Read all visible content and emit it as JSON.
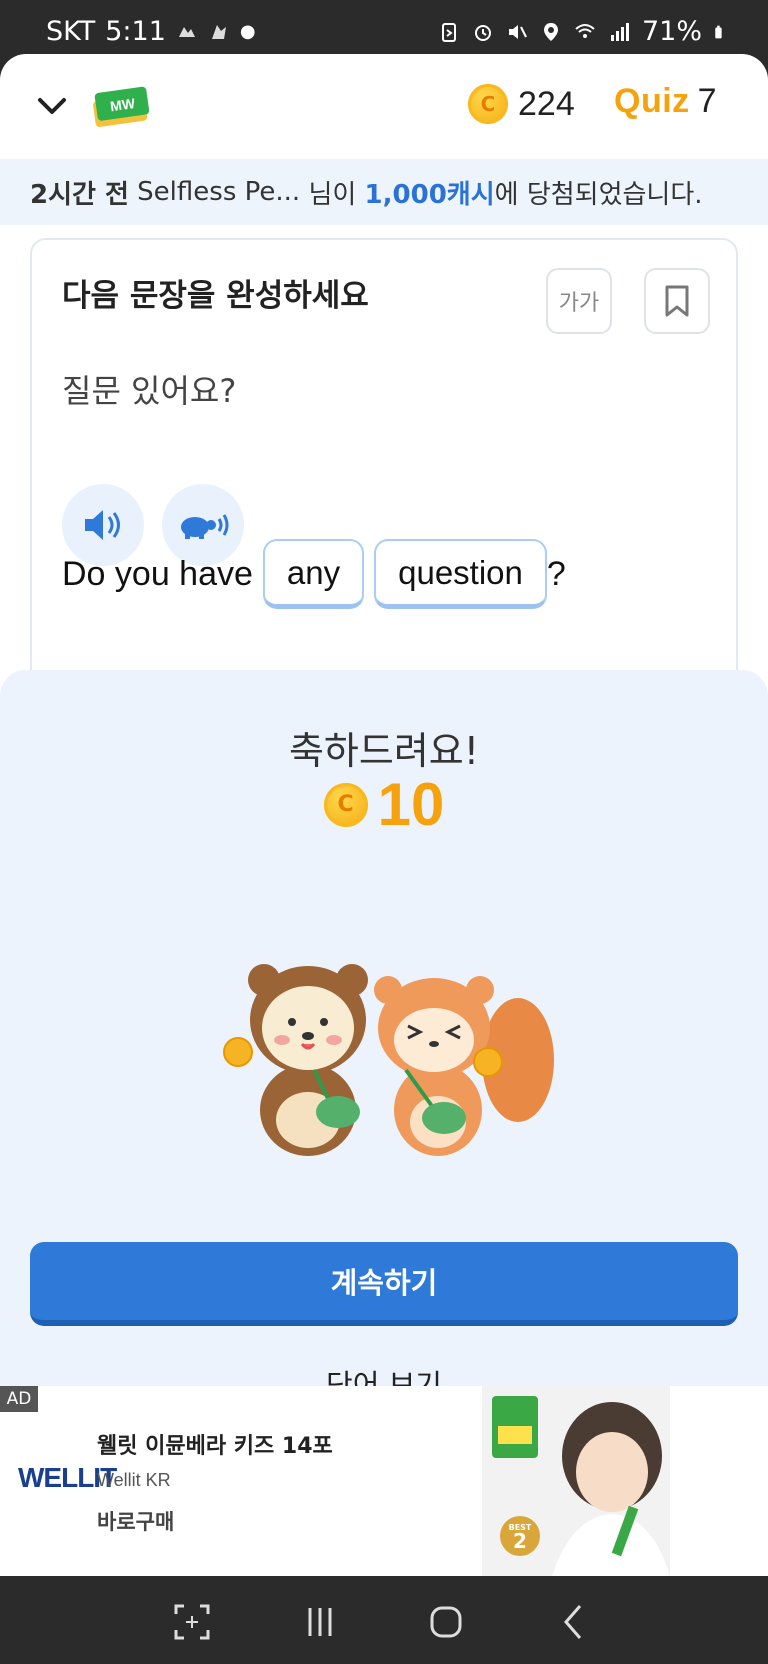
{
  "status_bar": {
    "carrier": "SKT",
    "time": "5:11",
    "battery": "71%"
  },
  "header": {
    "logo_text": "MW",
    "coin_count": "224",
    "quiz_label": "Quiz",
    "quiz_count": "7"
  },
  "banner": {
    "time_ago": "2시간 전",
    "user": "Selfless Pe...",
    "mid": "님이",
    "amount": "1,000캐시",
    "suffix": "에 당첨되었습니다."
  },
  "quiz_card": {
    "title": "다음 문장을 완성하세요",
    "font_size_button": "가가",
    "question": "질문 있어요?",
    "sentence_prefix": "Do you have",
    "answers": [
      "any",
      "question"
    ],
    "sentence_suffix": "?"
  },
  "result": {
    "message": "축하드려요!",
    "reward": "10",
    "continue_label": "계속하기",
    "view_words_label": "단어 보기"
  },
  "ad": {
    "tag": "AD",
    "brand": "WELLIT",
    "title": "웰릿 이뮨베라 키즈 14포",
    "advertiser": "Wellit KR",
    "cta": "바로구매",
    "badge_label": "BEST",
    "badge_number": "2"
  },
  "colors": {
    "primary": "#2f7ad8",
    "coin": "#f5a20c",
    "sheet_bg": "#ecf3fd"
  }
}
